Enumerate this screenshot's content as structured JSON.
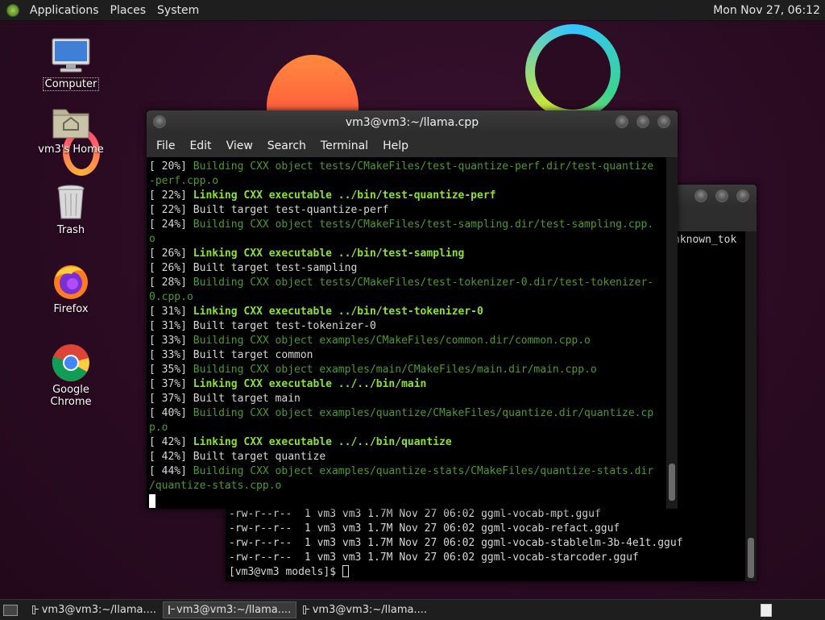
{
  "top_panel": {
    "menus": [
      "Applications",
      "Places",
      "System"
    ],
    "clock": "Mon Nov 27, 06:12"
  },
  "desktop_icons": [
    {
      "label": "Computer",
      "icon": "computer-icon"
    },
    {
      "label": "vm3's Home",
      "icon": "home-folder-icon"
    },
    {
      "label": "Trash",
      "icon": "trash-icon"
    },
    {
      "label": "Firefox",
      "icon": "firefox-icon"
    },
    {
      "label": "Google Chrome",
      "icon": "chrome-icon"
    }
  ],
  "front_window": {
    "title": "vm3@vm3:~/llama.cpp",
    "menu": [
      "File",
      "Edit",
      "View",
      "Search",
      "Terminal",
      "Help"
    ],
    "lines": [
      {
        "pct": "[ 20%] ",
        "kind": "building",
        "text": "Building CXX object tests/CMakeFiles/test-quantize-perf.dir/test-quantize"
      },
      {
        "pct": "",
        "kind": "building",
        "text": "-perf.cpp.o"
      },
      {
        "pct": "[ 22%] ",
        "kind": "linking",
        "text": "Linking CXX executable ../bin/test-quantize-perf"
      },
      {
        "pct": "[ 22%] ",
        "kind": "plain",
        "text": "Built target test-quantize-perf"
      },
      {
        "pct": "[ 24%] ",
        "kind": "building",
        "text": "Building CXX object tests/CMakeFiles/test-sampling.dir/test-sampling.cpp."
      },
      {
        "pct": "",
        "kind": "building",
        "text": "o"
      },
      {
        "pct": "[ 26%] ",
        "kind": "linking",
        "text": "Linking CXX executable ../bin/test-sampling"
      },
      {
        "pct": "[ 26%] ",
        "kind": "plain",
        "text": "Built target test-sampling"
      },
      {
        "pct": "[ 28%] ",
        "kind": "building",
        "text": "Building CXX object tests/CMakeFiles/test-tokenizer-0.dir/test-tokenizer-"
      },
      {
        "pct": "",
        "kind": "building",
        "text": "0.cpp.o"
      },
      {
        "pct": "[ 31%] ",
        "kind": "linking",
        "text": "Linking CXX executable ../bin/test-tokenizer-0"
      },
      {
        "pct": "[ 31%] ",
        "kind": "plain",
        "text": "Built target test-tokenizer-0"
      },
      {
        "pct": "[ 33%] ",
        "kind": "building",
        "text": "Building CXX object examples/CMakeFiles/common.dir/common.cpp.o"
      },
      {
        "pct": "[ 33%] ",
        "kind": "plain",
        "text": "Built target common"
      },
      {
        "pct": "[ 35%] ",
        "kind": "building",
        "text": "Building CXX object examples/main/CMakeFiles/main.dir/main.cpp.o"
      },
      {
        "pct": "[ 37%] ",
        "kind": "linking",
        "text": "Linking CXX executable ../../bin/main"
      },
      {
        "pct": "[ 37%] ",
        "kind": "plain",
        "text": "Built target main"
      },
      {
        "pct": "[ 40%] ",
        "kind": "building",
        "text": "Building CXX object examples/quantize/CMakeFiles/quantize.dir/quantize.cp"
      },
      {
        "pct": "",
        "kind": "building",
        "text": "p.o"
      },
      {
        "pct": "[ 42%] ",
        "kind": "linking",
        "text": "Linking CXX executable ../../bin/quantize"
      },
      {
        "pct": "[ 42%] ",
        "kind": "plain",
        "text": "Built target quantize"
      },
      {
        "pct": "[ 44%] ",
        "kind": "building",
        "text": "Building CXX object examples/quantize-stats/CMakeFiles/quantize-stats.dir"
      },
      {
        "pct": "",
        "kind": "building",
        "text": "/quantize-stats.cpp.o"
      }
    ]
  },
  "back_window": {
    "partial_text": "nknown_tok",
    "lines": [
      "-rw-r--r--  1 vm3 vm3 1.7M Nov 27 06:02 ggml-vocab-mpt.gguf",
      "-rw-r--r--  1 vm3 vm3 1.7M Nov 27 06:02 ggml-vocab-refact.gguf",
      "-rw-r--r--  1 vm3 vm3 1.7M Nov 27 06:02 ggml-vocab-stablelm-3b-4e1t.gguf",
      "-rw-r--r--  1 vm3 vm3 1.7M Nov 27 06:02 ggml-vocab-starcoder.gguf"
    ],
    "prompt": "[vm3@vm3 models]$ "
  },
  "taskbar": {
    "tasks": [
      {
        "label": "vm3@vm3:~/llama....",
        "active": false
      },
      {
        "label": "vm3@vm3:~/llama....",
        "active": true
      },
      {
        "label": "vm3@vm3:~/llama....",
        "active": false
      }
    ]
  },
  "colors": {
    "building": "#4e9a2a",
    "linking": "#8ae234",
    "panel": "#1e1e1e"
  }
}
